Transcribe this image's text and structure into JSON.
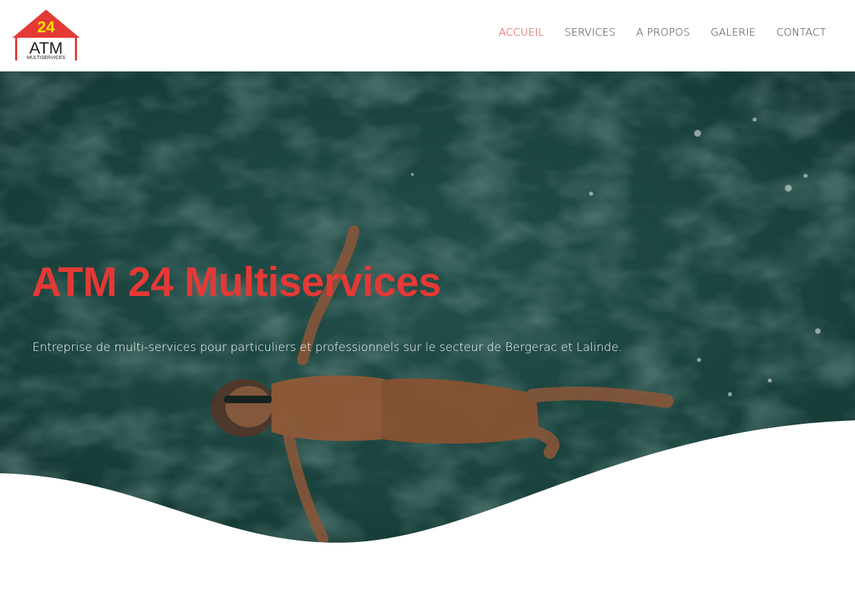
{
  "logo": {
    "number": "24",
    "name": "ATM",
    "tagline": "MULTISERVICES",
    "colors": {
      "roof": "#e53935",
      "number": "#f5e400",
      "text": "#222222"
    }
  },
  "nav": {
    "items": [
      {
        "label": "ACCUEIL",
        "active": true
      },
      {
        "label": "SERVICES",
        "active": false
      },
      {
        "label": "A PROPOS",
        "active": false
      },
      {
        "label": "GALERIE",
        "active": false
      },
      {
        "label": "CONTACT",
        "active": false
      }
    ]
  },
  "hero": {
    "title": "ATM 24 Multiservices",
    "subtitle": "Entreprise de multi-services pour particuliers et professionnels sur le secteur de Bergerac et Lalinde.",
    "background": "pool-water-swimmer-photo"
  },
  "colors": {
    "accent": "#e53935",
    "nav_active": "#d32f2f",
    "nav_text": "#333333",
    "water": "#1f4d48"
  }
}
